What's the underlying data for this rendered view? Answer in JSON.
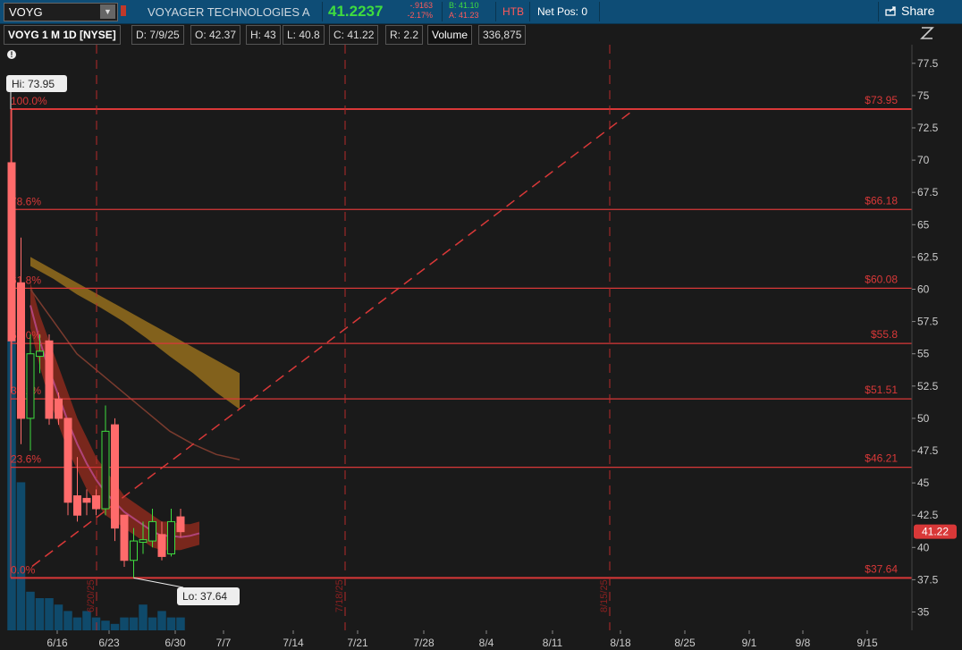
{
  "topbar": {
    "symbol": "VOYG",
    "company": "VOYAGER TECHNOLOGIES A",
    "last": "41.2237",
    "change": "-.9163",
    "change_pct": "-2.17%",
    "bid": "B: 41.10",
    "ask": "A: 41.23",
    "htb": "HTB",
    "net_pos": "Net Pos: 0",
    "share": "Share",
    "icons": [
      "chevron-down-icon",
      "share-icon",
      "collapse-icon"
    ]
  },
  "infobar": {
    "title": "VOYG 1 M 1D [NYSE]",
    "date": "D: 7/9/25",
    "open": "O: 42.37",
    "high": "H: 43",
    "low": "L: 40.8",
    "close": "C: 41.22",
    "range": "R: 2.2",
    "volume_label": "Volume",
    "volume_value": "336,875"
  },
  "colors": {
    "up": "#3fdc3f",
    "down": "#ff6b6b",
    "fib": "#d93838",
    "grid": "#333",
    "topbar": "#0e4d76",
    "background": "#1a1a1a",
    "volume": "#0f4a6b"
  },
  "chart_data": {
    "type": "candlestick",
    "ylim": [
      33,
      78.5
    ],
    "yticks": [
      35,
      37.5,
      40,
      42.5,
      45,
      47.5,
      50,
      52.5,
      55,
      57.5,
      60,
      62.5,
      65,
      67.5,
      70,
      72.5,
      75,
      77.5
    ],
    "x_tick_labels": [
      "6/16",
      "6/23",
      "6/30",
      "7/7",
      "7/14",
      "7/21",
      "7/28",
      "8/4",
      "8/11",
      "8/18",
      "8/25",
      "9/1",
      "9/8",
      "9/15"
    ],
    "candles": [
      {
        "o": 69.8,
        "h": 73.95,
        "l": 52.0,
        "c": 56.0,
        "dir": "down"
      },
      {
        "o": 60.5,
        "h": 64.0,
        "l": 48.0,
        "c": 50.0,
        "dir": "down"
      },
      {
        "o": 50.0,
        "h": 56.5,
        "l": 47.5,
        "c": 55.0,
        "dir": "up"
      },
      {
        "o": 54.8,
        "h": 56.5,
        "l": 53.5,
        "c": 55.2,
        "dir": "up"
      },
      {
        "o": 56.0,
        "h": 56.5,
        "l": 49.5,
        "c": 50.0,
        "dir": "down"
      },
      {
        "o": 51.5,
        "h": 52.0,
        "l": 49.5,
        "c": 50.0,
        "dir": "down"
      },
      {
        "o": 50.0,
        "h": 50.0,
        "l": 42.5,
        "c": 43.5,
        "dir": "down"
      },
      {
        "o": 44.0,
        "h": 47.0,
        "l": 42.0,
        "c": 42.5,
        "dir": "down"
      },
      {
        "o": 43.5,
        "h": 44.5,
        "l": 42.5,
        "c": 43.8,
        "dir": "down"
      },
      {
        "o": 44.0,
        "h": 44.5,
        "l": 42.5,
        "c": 43.0,
        "dir": "down"
      },
      {
        "o": 43.0,
        "h": 51.0,
        "l": 42.5,
        "c": 49.0,
        "dir": "up"
      },
      {
        "o": 49.5,
        "h": 50.0,
        "l": 40.5,
        "c": 41.5,
        "dir": "down"
      },
      {
        "o": 42.5,
        "h": 42.5,
        "l": 38.5,
        "c": 39.0,
        "dir": "down"
      },
      {
        "o": 39.0,
        "h": 41.5,
        "l": 37.64,
        "c": 40.5,
        "dir": "up"
      },
      {
        "o": 40.4,
        "h": 42.0,
        "l": 39.5,
        "c": 40.6,
        "dir": "up"
      },
      {
        "o": 40.5,
        "h": 43.0,
        "l": 40.0,
        "c": 42.0,
        "dir": "up"
      },
      {
        "o": 41.0,
        "h": 42.0,
        "l": 39.0,
        "c": 39.3,
        "dir": "down"
      },
      {
        "o": 39.5,
        "h": 43.0,
        "l": 39.3,
        "c": 42.0,
        "dir": "up"
      },
      {
        "o": 42.37,
        "h": 43.0,
        "l": 40.8,
        "c": 41.22,
        "dir": "down"
      }
    ],
    "volume_bars": [
      45,
      23,
      6,
      5,
      5,
      4,
      3,
      2,
      3,
      2,
      1.5,
      1,
      2,
      2,
      4,
      2,
      3,
      2,
      2
    ],
    "fib_levels": [
      {
        "pct": "100.0%",
        "price_label": "$73.95",
        "price": 73.95
      },
      {
        "pct": "78.6%",
        "price_label": "$66.18",
        "price": 66.18
      },
      {
        "pct": "61.8%",
        "price_label": "$60.08",
        "price": 60.08
      },
      {
        "pct": "50.0%",
        "price_label": "$55.8",
        "price": 55.8
      },
      {
        "pct": "38.2%",
        "price_label": "$51.51",
        "price": 51.51
      },
      {
        "pct": "23.6%",
        "price_label": "$46.21",
        "price": 46.21
      },
      {
        "pct": "0.0%",
        "price_label": "$37.64",
        "price": 37.64
      }
    ],
    "hi_label": "Hi: 73.95",
    "lo_label": "Lo: 37.64",
    "last_price_tag": "41.22",
    "vertical_markers": [
      "6/20/25",
      "7/18/25",
      "8/15/25"
    ],
    "trendline": {
      "from_price": 37.64,
      "to_price": 73.95
    },
    "bands": {
      "red_band_upper": [
        60.5,
        58,
        56,
        54,
        52,
        50,
        48.5,
        47,
        46,
        45,
        44,
        43.5,
        43,
        42.5,
        42,
        42,
        41.8,
        41.8,
        42
      ],
      "red_band_lower": [
        57,
        54,
        51.5,
        49.5,
        47.5,
        46,
        44.5,
        43.5,
        42.5,
        42,
        41.5,
        41,
        40.5,
        40,
        39.8,
        39.8,
        39.8,
        40,
        40.2
      ],
      "gold_band_upper": [
        62.5,
        61.5,
        60.5,
        59.5,
        58.5,
        57.5,
        56.5,
        55.5,
        54.5,
        53.5
      ],
      "gold_band_lower": [
        61.8,
        60.8,
        59.6,
        58.6,
        57.5,
        56.2,
        54.8,
        53.5,
        52,
        50.7
      ],
      "ma_line": [
        60.0,
        57.5,
        55,
        53.5,
        52,
        50.5,
        49,
        48,
        47.2,
        46.8
      ]
    }
  }
}
